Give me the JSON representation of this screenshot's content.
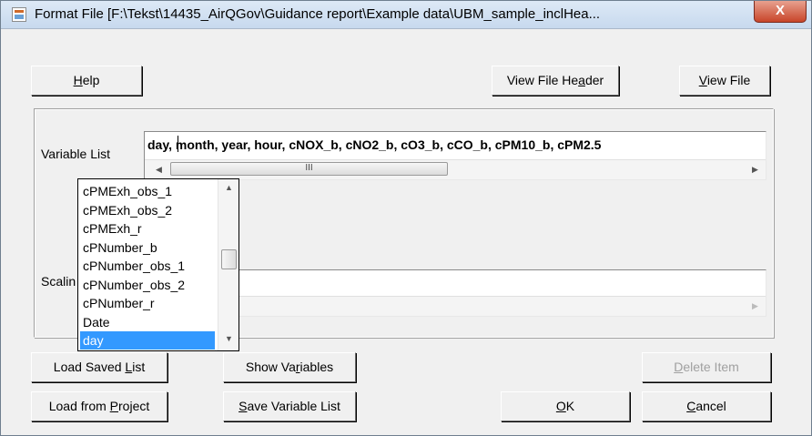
{
  "window": {
    "title": "Format File [F:\\Tekst\\14435_AirQGov\\Guidance report\\Example data\\UBM_sample_inclHea...",
    "close_glyph": "X"
  },
  "top_buttons": {
    "help": {
      "pre": "",
      "u": "H",
      "post": "elp"
    },
    "view_file_header": {
      "pre": "View File He",
      "u": "a",
      "post": "der"
    },
    "view_file": {
      "pre": "",
      "u": "V",
      "post": "iew File"
    }
  },
  "variable_list": {
    "label": "Variable List",
    "value": "day, month, year, hour, cNOX_b, cNO2_b, cO3_b, cCO_b, cPM10_b, cPM2.5",
    "scroll_glyph": "III",
    "scroll_position": 0.0
  },
  "scaling": {
    "label": "Scalin",
    "value": ""
  },
  "dropdown": {
    "items": [
      "cPMExh_obs_1",
      "cPMExh_obs_2",
      "cPMExh_r",
      "cPNumber_b",
      "cPNumber_obs_1",
      "cPNumber_obs_2",
      "cPNumber_r",
      "Date",
      "day"
    ],
    "selected": "day",
    "scroll_position": 0.45
  },
  "bottom_buttons": {
    "load_saved_list": {
      "pre": "Load Saved ",
      "u": "L",
      "post": "ist"
    },
    "show_variables": {
      "pre": "Show Va",
      "u": "r",
      "post": "iables"
    },
    "delete_item": {
      "pre": "",
      "u": "D",
      "post": "elete Item"
    },
    "load_from_project": {
      "pre": "Load from ",
      "u": "P",
      "post": "roject"
    },
    "save_variable_list": {
      "pre": "",
      "u": "S",
      "post": "ave Variable List"
    },
    "ok": {
      "pre": "",
      "u": "O",
      "post": "K"
    },
    "cancel": {
      "pre": "",
      "u": "C",
      "post": "ancel"
    }
  },
  "colors": {
    "selection": "#3399ff",
    "dialog_bg": "#f0f0f0",
    "close_button": "#c8452a"
  }
}
